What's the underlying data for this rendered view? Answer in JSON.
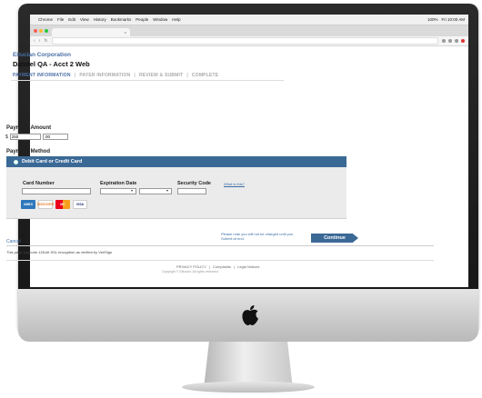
{
  "browser": {
    "menubar": {
      "items": [
        "Chrome",
        "File",
        "Edit",
        "View",
        "History",
        "Bookmarks",
        "People",
        "Window",
        "Help"
      ],
      "right": [
        "100%",
        "Fri 10:00 AM"
      ]
    },
    "tab_title": "",
    "tab_close": "×"
  },
  "header": {
    "org_name": "Ellucian Corporation",
    "site_name": "Datatel QA - Acct 2 Web"
  },
  "steps": [
    {
      "label": "PAYMENT INFORMATION",
      "active": true
    },
    {
      "label": "PAYER INFORMATION",
      "active": false
    },
    {
      "label": "REVIEW & SUBMIT",
      "active": false
    },
    {
      "label": "COMPLETE",
      "active": false
    }
  ],
  "step_separator": "|",
  "payment_amount": {
    "label": "Payment Amount",
    "currency": "$",
    "dollars_value": "250",
    "cents_value": ".00"
  },
  "payment_method": {
    "label": "Payment Method",
    "option_label": "Debit Card or Credit Card",
    "card_number_label": "Card Number",
    "expiration_label": "Expiration Date",
    "security_label": "Security Code",
    "whats_this": "What is this?",
    "card_logos": [
      "AMEX",
      "DISCOVER",
      "MC",
      "VISA"
    ]
  },
  "actions": {
    "cancel": "Cancel",
    "notice": "Please note you will not be charged until you Submit at end.",
    "continue": "Continue"
  },
  "secure_note": "This page supports 128-bit SSL encryption as verified by VeriSign",
  "footer": {
    "links": [
      "PRIVACY POLICY",
      "Complaints",
      "Legal Notices"
    ],
    "separator": "|",
    "copyright": "Copyright © Ellucian. All rights reserved."
  }
}
